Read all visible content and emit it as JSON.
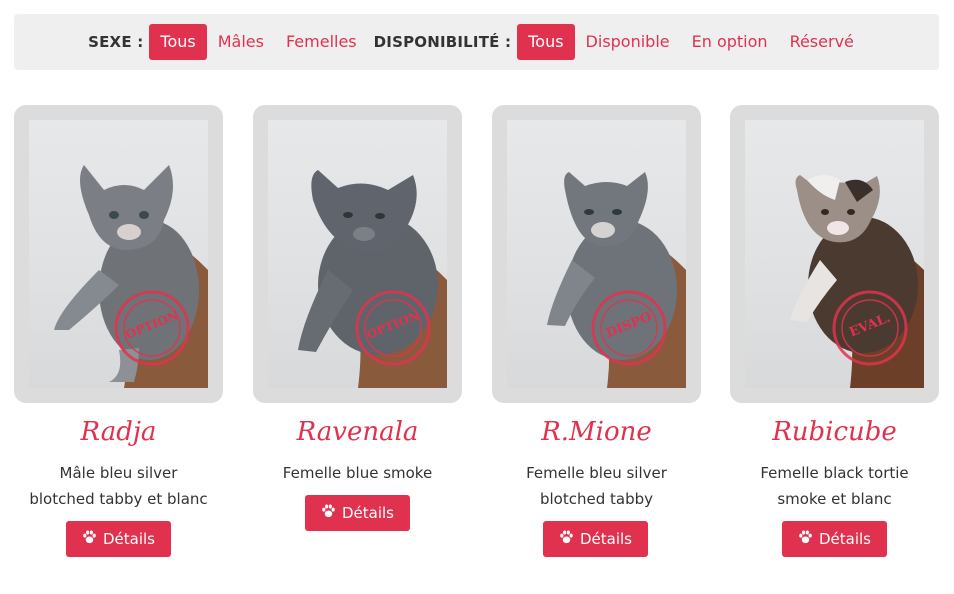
{
  "filters": {
    "sexe_label": "SEXE :",
    "sexe_options": [
      "Tous",
      "Mâles",
      "Femelles"
    ],
    "dispo_label": "DISPONIBILITÉ :",
    "dispo_options": [
      "Tous",
      "Disponible",
      "En option",
      "Réservé"
    ]
  },
  "colors": {
    "accent": "#e0324f",
    "filterbar_bg": "#efefef",
    "frame_bg": "#dcdcdc"
  },
  "button_icon": "paw-icon",
  "kittens": [
    {
      "name": "Radja",
      "desc1": "Mâle bleu silver",
      "desc2": "blotched tabby et blanc",
      "stamp": "OPTION",
      "stamp_small": "MOONWALK",
      "button": "Détails"
    },
    {
      "name": "Ravenala",
      "desc1": "Femelle blue smoke",
      "desc2": "",
      "stamp": "OPTION",
      "stamp_small": "MOONWALK",
      "button": "Détails"
    },
    {
      "name": "R.Mione",
      "desc1": "Femelle bleu silver",
      "desc2": "blotched tabby",
      "stamp": "DISPO",
      "stamp_small": "MOONWALK",
      "button": "Détails"
    },
    {
      "name": "Rubicube",
      "desc1": "Femelle black tortie",
      "desc2": "smoke et blanc",
      "stamp": "EVAL.",
      "stamp_small": "MOONWALK",
      "button": "Détails"
    }
  ]
}
